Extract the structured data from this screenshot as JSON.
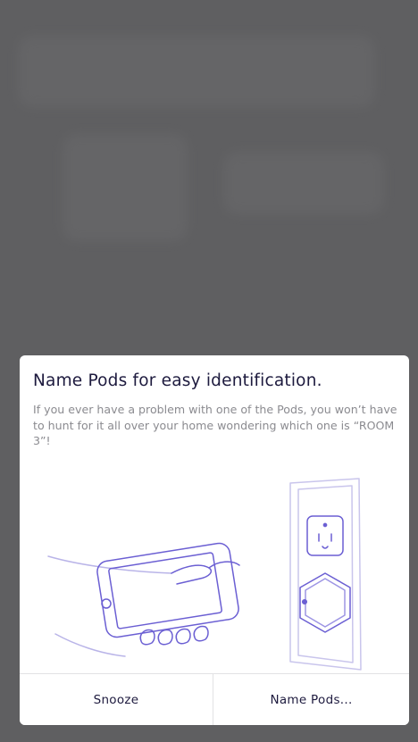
{
  "dialog": {
    "title": "Name Pods for easy identification.",
    "message": "If you ever have a problem with one of the Pods, you won’t have to hunt for it all over your home wondering which one is “ROOM 3”!",
    "illustration_icons": [
      "hand-holding-phone-icon",
      "wall-outlet-icon",
      "hexagon-pod-icon"
    ]
  },
  "actions": {
    "snooze_label": "Snooze",
    "name_pods_label": "Name Pods..."
  },
  "colors": {
    "title_text": "#1d1a3e",
    "body_text": "#8b8b90",
    "illustration_stroke": "#6b5fd3",
    "overlay": "#5f5f61",
    "sheet": "#ffffff"
  }
}
